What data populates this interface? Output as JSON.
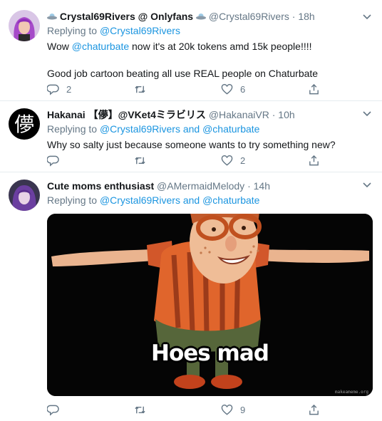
{
  "tweets": [
    {
      "display_name": "Crystal69Rivers @ Onlyfans",
      "handle": "@Crystal69Rivers",
      "separator": "·",
      "time": "18h",
      "replying_label": "Replying to",
      "replying_to": "@Crystal69Rivers",
      "text_prefix": "Wow",
      "text_mention": "@chaturbate",
      "text_rest": "now it's at 20k tokens amd 15k people!!!!",
      "text_para2": "Good job cartoon beating all use REAL people on Chaturbate",
      "reply_count": "2",
      "retweet_count": "",
      "like_count": "6",
      "avatar_icon": "profile-photo-purple-hair",
      "emoji_icon": "ufo-emoji"
    },
    {
      "display_name": "Hakanai 【儚】@VKet4ミラビリス",
      "handle": "@HakanaiVR",
      "separator": "·",
      "time": "10h",
      "replying_label": "Replying to",
      "replying_to": "@Crystal69Rivers",
      "and_label": "and",
      "replying_to_2": "@chaturbate",
      "text": "Why so salty just because someone wants to try something new?",
      "reply_count": "",
      "retweet_count": "",
      "like_count": "2",
      "avatar_glyph": "儚"
    },
    {
      "display_name": "Cute moms enthusiast",
      "handle": "@AMermaidMelody",
      "separator": "·",
      "time": "14h",
      "replying_label": "Replying to",
      "replying_to": "@Crystal69Rivers",
      "and_label": "and",
      "replying_to_2": "@chaturbate",
      "media_caption": "Hoes mad",
      "media_watermark": "makeameme.org",
      "reply_count": "",
      "retweet_count": "",
      "like_count": "9",
      "avatar_icon": "profile-photo-purple-hair"
    }
  ],
  "colors": {
    "link": "#1b95e0",
    "meta": "#657786",
    "text": "#14171a",
    "divider": "#e6ecf0"
  }
}
